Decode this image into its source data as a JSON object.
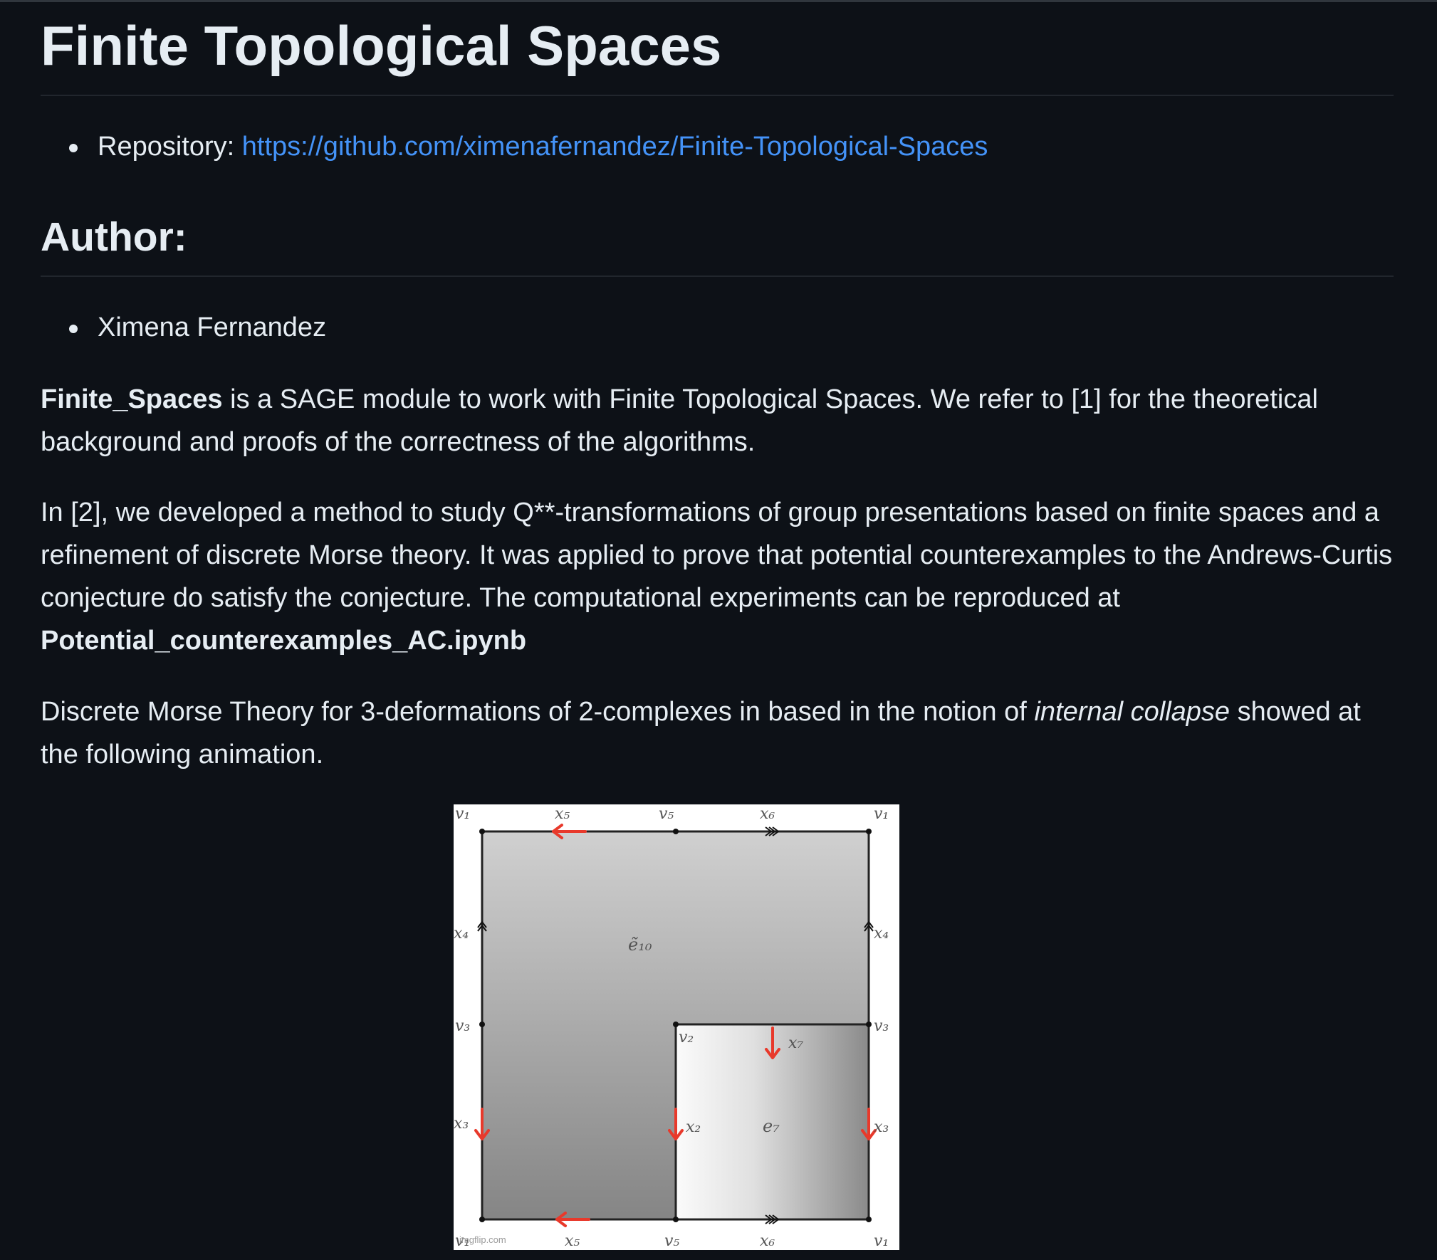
{
  "title": "Finite Topological Spaces",
  "repository": {
    "label": "Repository: ",
    "url": "https://github.com/ximenafernandez/Finite-Topological-Spaces"
  },
  "author_heading": "Author:",
  "authors": [
    "Ximena Fernandez"
  ],
  "paragraph1": {
    "bold": "Finite_Spaces",
    "text": " is a SAGE module to work with Finite Topological Spaces. We refer to [1] for the theoretical background and proofs of the correctness of the algorithms."
  },
  "paragraph2": {
    "text": "In [2], we developed a method to study Q**-transformations of group presentations based on finite spaces and a refinement of discrete Morse theory. It was applied to prove that potential counterexamples to the Andrews-Curtis conjecture do satisfy the conjecture. The computational experiments can be reproduced at ",
    "bold": "Potential_counterexamples_AC.ipynb"
  },
  "paragraph3": {
    "text_before": "Discrete Morse Theory for 3-deformations of 2-complexes in based in the notion of ",
    "italic": "internal collapse",
    "text_after": " showed at the following animation."
  },
  "figure": {
    "vertex_labels": {
      "v1": "v₁",
      "v2": "v₂",
      "v3": "v₃",
      "v5": "v₅"
    },
    "edge_labels": {
      "x2": "x₂",
      "x3": "x₃",
      "x4": "x₄",
      "x5": "x₅",
      "x6": "x₆",
      "x7": "x₇"
    },
    "cell_labels": {
      "e10": "ẽ₁₀",
      "e7": "e₇"
    },
    "watermark": "imgflip.com",
    "arrow_color": "#e8392b"
  }
}
